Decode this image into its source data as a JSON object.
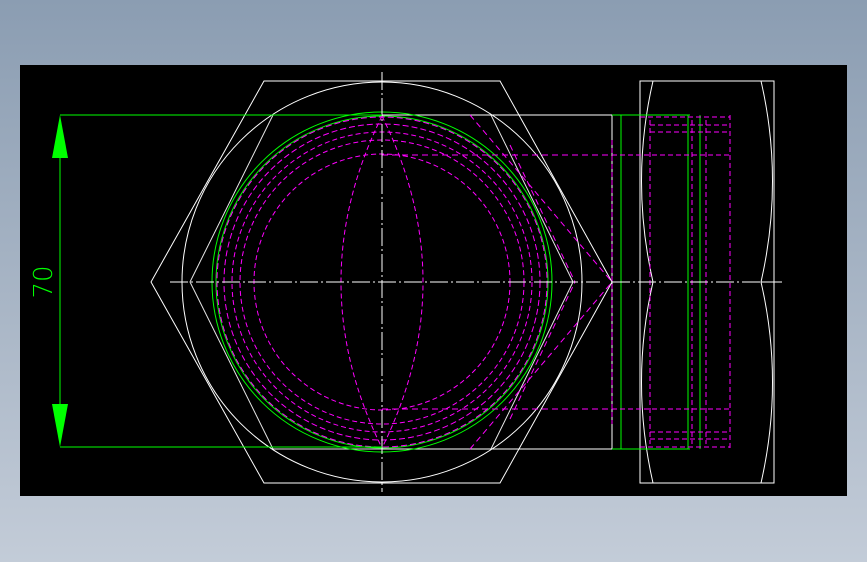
{
  "dimension": {
    "value_text": "70"
  },
  "colors": {
    "background": "#000000",
    "outline": "#ffffff",
    "dimension": "#00ff00",
    "hidden_lines": "#ff00ff",
    "viewport_bg_top": "#8b9db2",
    "viewport_bg_bottom": "#c3ccd8"
  },
  "views": [
    "front-view",
    "side-view"
  ]
}
